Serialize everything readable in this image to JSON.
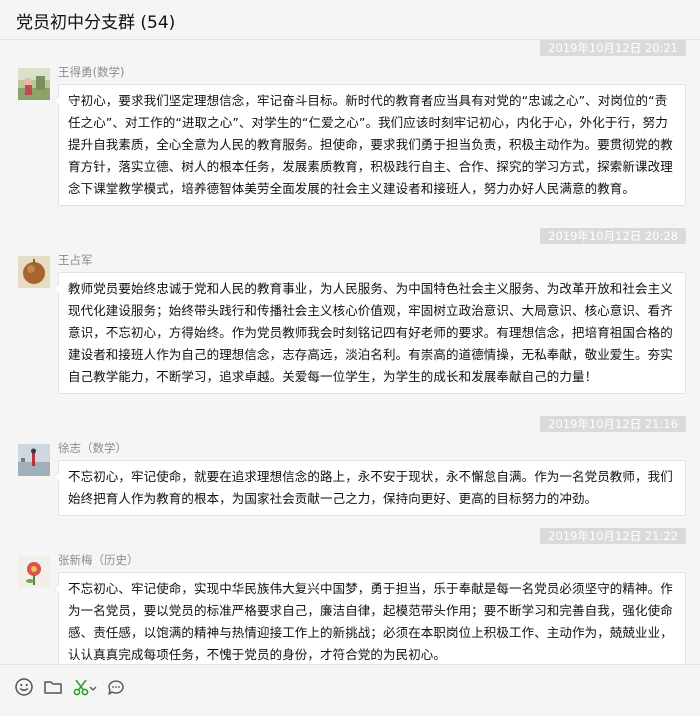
{
  "window": {
    "title": "党员初中分支群 (54)"
  },
  "messages": [
    {
      "time": "2019年10月12日 20:21",
      "sender": "王得勇(数学)",
      "avatar": "avatar-photo-outdoor",
      "text": "守初心，要求我们坚定理想信念，牢记奋斗目标。新时代的教育者应当具有对党的“忠诚之心”、对岗位的“责任之心”、对工作的“进取之心”、对学生的“仁爱之心”。我们应该时刻牢记初心，内化于心，外化于行，努力提升自我素质，全心全意为人民的教育服务。担使命，要求我们勇于担当负责，积极主动作为。要贯彻党的教育方针，落实立德、树人的根本任务，发展素质教育，积极践行自主、合作、探究的学习方式，探索新课改理念下课堂教学模式，培养德智体美劳全面发展的社会主义建设者和接班人，努力办好人民满意的教育。"
    },
    {
      "time": "2019年10月12日 20:28",
      "sender": "王占军",
      "avatar": "avatar-photo-fruit",
      "text": "教师党员要始终忠诚于党和人民的教育事业，为人民服务、为中国特色社会主义服务、为改革开放和社会主义现代化建设服务；始终带头践行和传播社会主义核心价值观，牢固树立政治意识、大局意识、核心意识、看齐意识，不忘初心，方得始终。作为党员教师我会时刻铭记四有好老师的要求。有理想信念，把培育祖国合格的建设者和接班人作为自己的理想信念，志存高远，淡泊名利。有崇高的道德情操，无私奉献，敬业爱生。夯实自己教学能力，不断学习，追求卓越。关爱每一位学生，为学生的成长和发展奉献自己的力量！"
    },
    {
      "time": "2019年10月12日 21:16",
      "sender": "徐志（数学）",
      "avatar": "avatar-photo-lake",
      "text": "不忘初心，牢记使命，就要在追求理想信念的路上，永不安于现状，永不懈怠自满。作为一名党员教师，我们始终把育人作为教育的根本，为国家社会贡献一己之力，保持向更好、更高的目标努力的冲劲。"
    },
    {
      "time": "2019年10月12日 21:22",
      "sender": "张新梅（历史）",
      "avatar": "avatar-photo-flower",
      "text": "不忘初心、牢记使命，实现中华民族伟大复兴中国梦，勇于担当，乐于奉献是每一名党员必须坚守的精神。作为一名党员，要以党员的标准严格要求自己，廉洁自律，起模范带头作用；要不断学习和完善自我，强化使命感、责任感，以饱满的精神与热情迎接工作上的新挑战；必须在本职岗位上积极工作、主动作为，兢兢业业，认认真真完成每项任务，不愧于党员的身份，才符合党的为民初心。"
    }
  ],
  "toolbar": {
    "icons": [
      "emoji-icon",
      "folder-icon",
      "screenshot-scissors-icon",
      "chevron-down-icon",
      "chat-history-icon"
    ]
  },
  "colors": {
    "background": "#f5f5f5",
    "bubble": "#ffffff",
    "bubble_border": "#e1e1e1",
    "time_badge": "#dadada",
    "scissors": "#2ea32e"
  }
}
